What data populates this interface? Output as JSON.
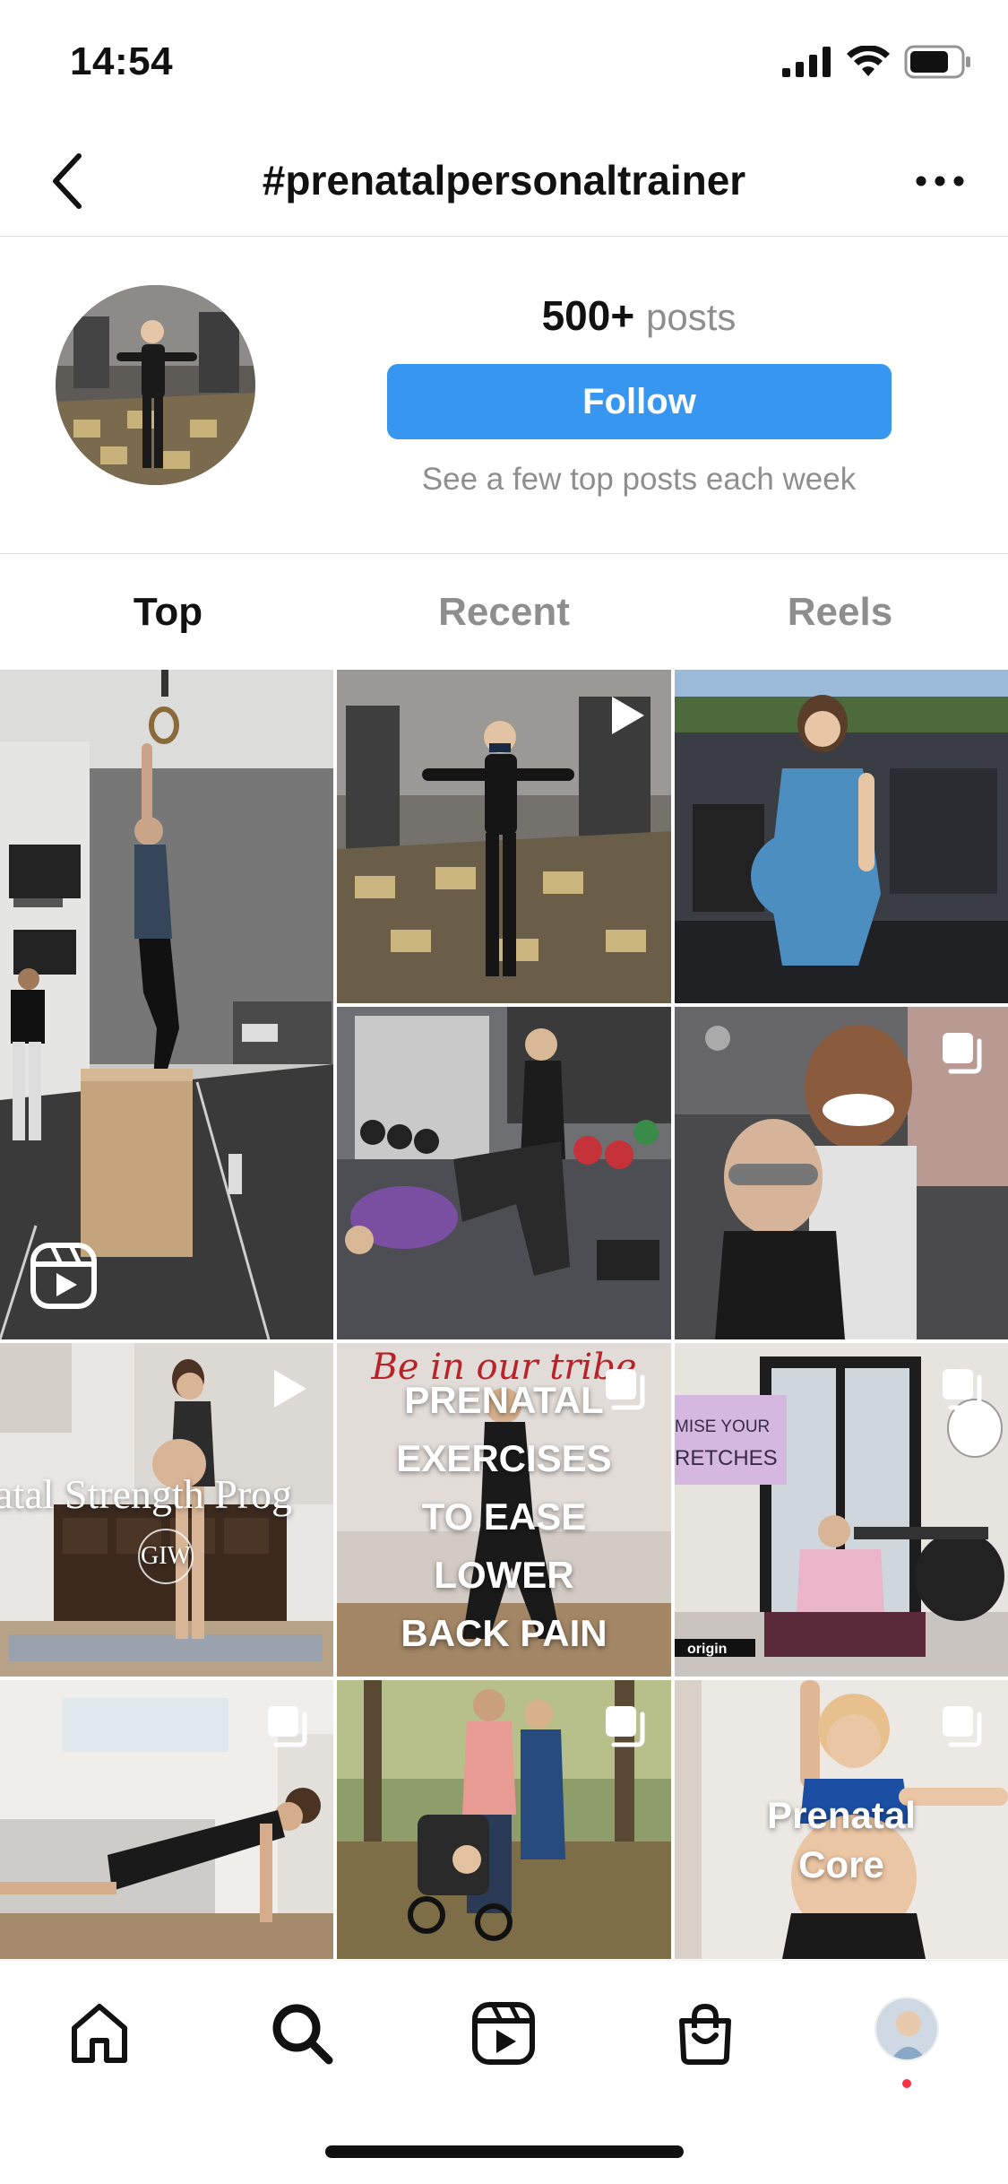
{
  "status_bar": {
    "time": "14:54"
  },
  "nav": {
    "title": "#prenatalpersonaltrainer"
  },
  "profile": {
    "post_count": "500+",
    "post_label": "posts",
    "follow_label": "Follow",
    "subtitle": "See a few top posts each week"
  },
  "tabs": [
    {
      "label": "Top",
      "active": true
    },
    {
      "label": "Recent",
      "active": false
    },
    {
      "label": "Reels",
      "active": false
    }
  ],
  "grid": {
    "tile_gym_man_text": "",
    "tile_prenatal_strength": "atal Strength Prog",
    "tile_giw": "GIW",
    "tile_belinourtribe": "Be in our tribe",
    "tile_exercises_lines": [
      "PRENATAL",
      "EXERCISES",
      "TO EASE",
      "LOWER",
      "BACK PAIN"
    ],
    "tile_stretches_lines": [
      "MISE YOUR",
      "RETCHES"
    ],
    "tile_origin": "origin",
    "tile_core_lines": [
      "Prenatal",
      "Core"
    ]
  },
  "icons": {
    "back": "chevron-left-icon",
    "more": "more-horizontal-icon",
    "signal": "cell-signal-icon",
    "wifi": "wifi-icon",
    "battery": "battery-icon",
    "reel": "reel-icon",
    "play": "play-icon",
    "carousel": "carousel-icon",
    "home": "home-icon",
    "search": "search-icon",
    "reels_tab": "reels-icon",
    "shop": "shop-icon"
  },
  "colors": {
    "accent": "#3797f0",
    "muted": "#8e8e8e",
    "notification": "#ff3040"
  }
}
